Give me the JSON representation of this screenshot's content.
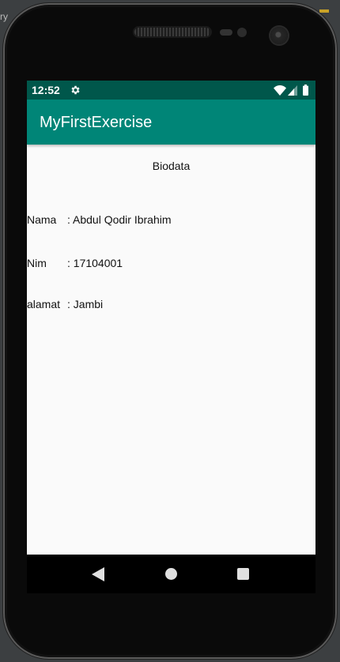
{
  "ide": {
    "fragment_top": "ry",
    "fragment_mid1": "",
    "fragment_mid2": ""
  },
  "status_bar": {
    "time": "12:52",
    "icons": [
      "gear-icon",
      "wifi-icon",
      "signal-icon",
      "battery-icon"
    ]
  },
  "app_bar": {
    "title": "MyFirstExercise",
    "color": "#008577",
    "status_color": "#00574b"
  },
  "content": {
    "heading": "Biodata",
    "rows": [
      {
        "label": "Nama",
        "value": ": Abdul Qodir Ibrahim"
      },
      {
        "label": "Nim",
        "value": ": 17104001"
      },
      {
        "label": "alamat",
        "value": ": Jambi"
      }
    ]
  },
  "nav_bar": {
    "icons": [
      "back-icon",
      "home-icon",
      "recents-icon"
    ]
  }
}
